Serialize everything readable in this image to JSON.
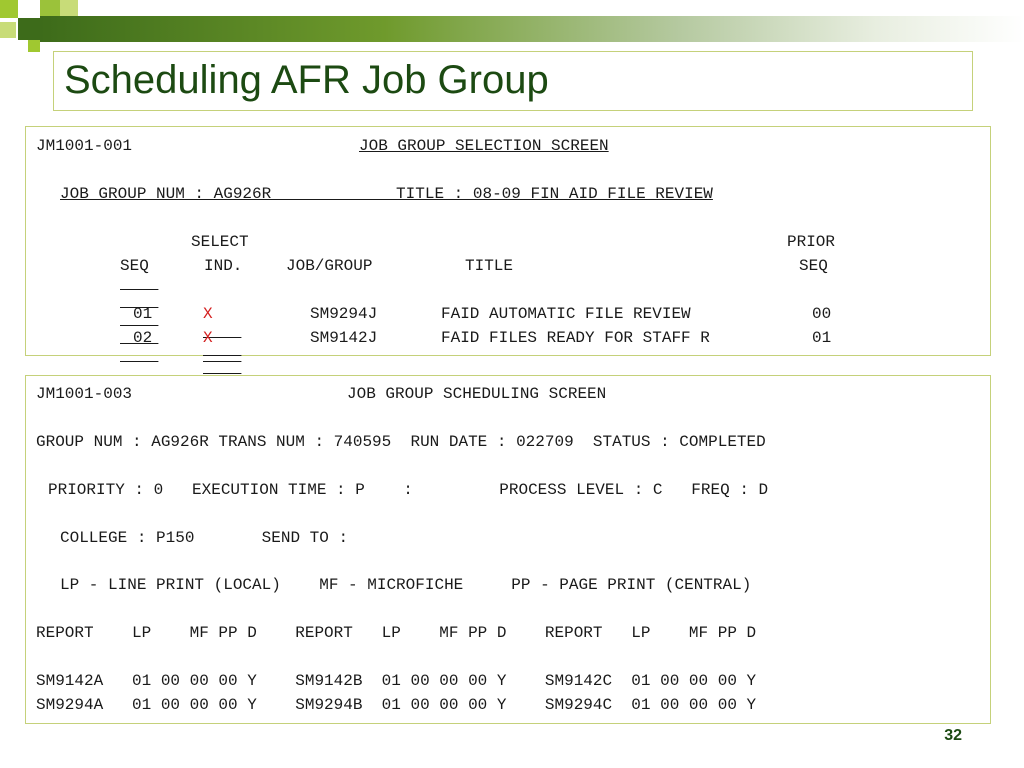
{
  "slide": {
    "title": "Scheduling AFR Job Group",
    "page_number": "32"
  },
  "selection_screen": {
    "screen_id": "JM1001-001",
    "heading": "JOB GROUP SELECTION SCREEN",
    "group_line": "JOB GROUP NUM : AG926R             TITLE : 08-09 FIN AID FILE REVIEW",
    "hdr_select": "SELECT",
    "hdr_prior": "PRIOR",
    "hdr_seq": "SEQ",
    "hdr_ind": "IND.",
    "hdr_jobgroup": "JOB/GROUP",
    "hdr_title": "TITLE",
    "hdr_prior_seq": "SEQ",
    "rows": [
      {
        "seq": "01",
        "ind": "X",
        "job": "SM9294J",
        "title": "FAID AUTOMATIC FILE REVIEW",
        "prior": "00"
      },
      {
        "seq": "02",
        "ind": "X",
        "job": "SM9142J",
        "title": "FAID FILES READY FOR STAFF R",
        "prior": "01"
      }
    ]
  },
  "scheduling_screen": {
    "screen_id": "JM1001-003",
    "heading": "JOB GROUP SCHEDULING SCREEN",
    "line_group": "GROUP NUM : AG926R TRANS NUM : 740595  RUN DATE : 022709  STATUS : COMPLETED",
    "line_priority": "PRIORITY : 0   EXECUTION TIME : P    :         PROCESS LEVEL : C   FREQ : D",
    "line_college": "COLLEGE : P150       SEND TO :",
    "line_print_opts": "LP - LINE PRINT (LOCAL)    MF - MICROFICHE     PP - PAGE PRINT (CENTRAL)",
    "report_header": "REPORT    LP    MF PP D    REPORT   LP    MF PP D    REPORT   LP    MF PP D",
    "report_rows": [
      "SM9142A   01 00 00 00 Y    SM9142B  01 00 00 00 Y    SM9142C  01 00 00 00 Y",
      "SM9294A   01 00 00 00 Y    SM9294B  01 00 00 00 Y    SM9294C  01 00 00 00 Y"
    ]
  },
  "colors": {
    "title_green": "#1c4a12",
    "border": "#c5d17a",
    "select_x": "#d42020"
  }
}
